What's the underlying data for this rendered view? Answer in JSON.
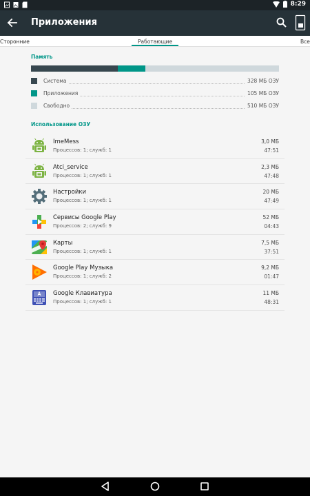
{
  "status_bar": {
    "time": "8:29"
  },
  "app_bar": {
    "title": "Приложения"
  },
  "tabs": {
    "left": "Сторонние",
    "active": "Работающие",
    "right": "Все"
  },
  "memory": {
    "title": "Память",
    "segments": [
      {
        "name": "Система",
        "value": "328 МБ ОЗУ",
        "color": "#37474f",
        "fraction": 0.349
      },
      {
        "name": "Приложения",
        "value": "105 МБ ОЗУ",
        "color": "#009688",
        "fraction": 0.112
      },
      {
        "name": "Свободно",
        "value": "510 МБ ОЗУ",
        "color": "#cfd8dc",
        "fraction": 0.539
      }
    ]
  },
  "ram_usage": {
    "title": "Использование ОЗУ",
    "apps": [
      {
        "name": "ImeMess",
        "details": "Процессов: 1; служб: 1",
        "size": "3,0 МБ",
        "time": "47:51",
        "icon": "android-robot-icon"
      },
      {
        "name": "Atci_service",
        "details": "Процессов: 1; служб: 1",
        "size": "2,3 МБ",
        "time": "47:48",
        "icon": "android-robot-icon"
      },
      {
        "name": "Настройки",
        "details": "Процессов: 1; служб: 1",
        "size": "20 МБ",
        "time": "47:49",
        "icon": "settings-gear-icon"
      },
      {
        "name": "Сервисы Google Play",
        "details": "Процессов: 2; служб: 9",
        "size": "52 МБ",
        "time": "04:43",
        "icon": "google-play-services-icon"
      },
      {
        "name": "Карты",
        "details": "Процессов: 1; служб: 1",
        "size": "7,5 МБ",
        "time": "37:51",
        "icon": "google-maps-icon"
      },
      {
        "name": "Google Play Музыка",
        "details": "Процессов: 1; служб: 2",
        "size": "9,2 МБ",
        "time": "01:47",
        "icon": "google-play-music-icon"
      },
      {
        "name": "Google Клавиатура",
        "details": "Процессов: 1; служб: 1",
        "size": "11 МБ",
        "time": "48:31",
        "icon": "google-keyboard-icon"
      }
    ]
  }
}
